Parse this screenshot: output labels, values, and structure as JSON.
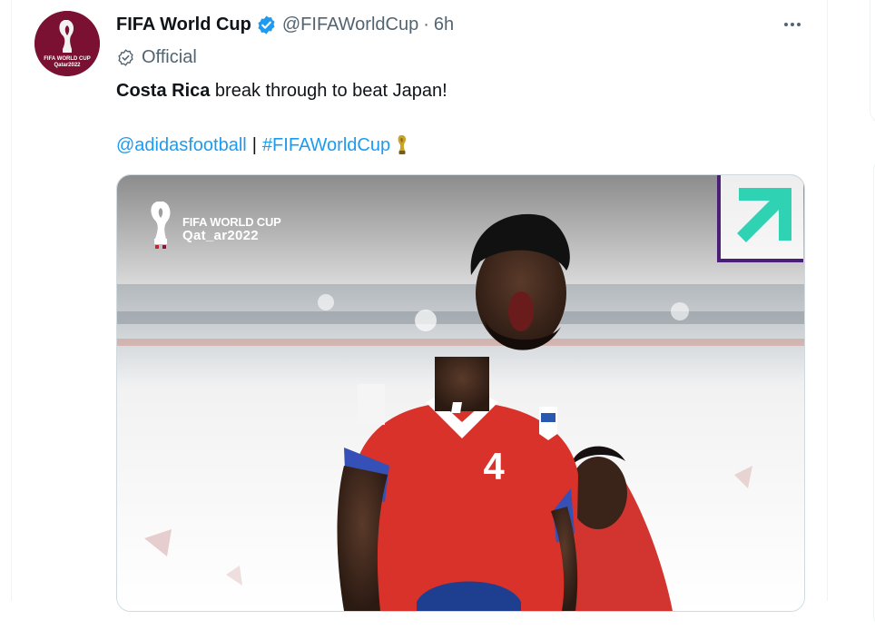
{
  "tweet": {
    "display_name": "FIFA World Cup",
    "handle": "@FIFAWorldCup",
    "separator": "·",
    "time": "6h",
    "label": "Official",
    "text_bold": "Costa Rica",
    "text_rest": " break through to beat Japan!",
    "mention": "@adidasfootball",
    "pipe": "|",
    "hashtag": "#FIFAWorldCup"
  },
  "avatar": {
    "line1": "FIFA WORLD CUP",
    "line2": "Qatar2022"
  },
  "media": {
    "brand_line1": "FIFA WORLD CUP",
    "brand_line2": "Qat_ar2022",
    "jersey_number": "4"
  },
  "icons": {
    "verified": "verified-badge-icon",
    "official": "official-badge-icon",
    "more": "more-options-icon",
    "trophy": "trophy-emoji-icon",
    "arrow": "arrow-up-right-icon"
  },
  "colors": {
    "link": "#1d9bf0",
    "secondary_text": "#536471",
    "avatar_bg": "#7a1133",
    "arrow": "#2fd3b4",
    "arrow_frame": "#4b1e78"
  }
}
